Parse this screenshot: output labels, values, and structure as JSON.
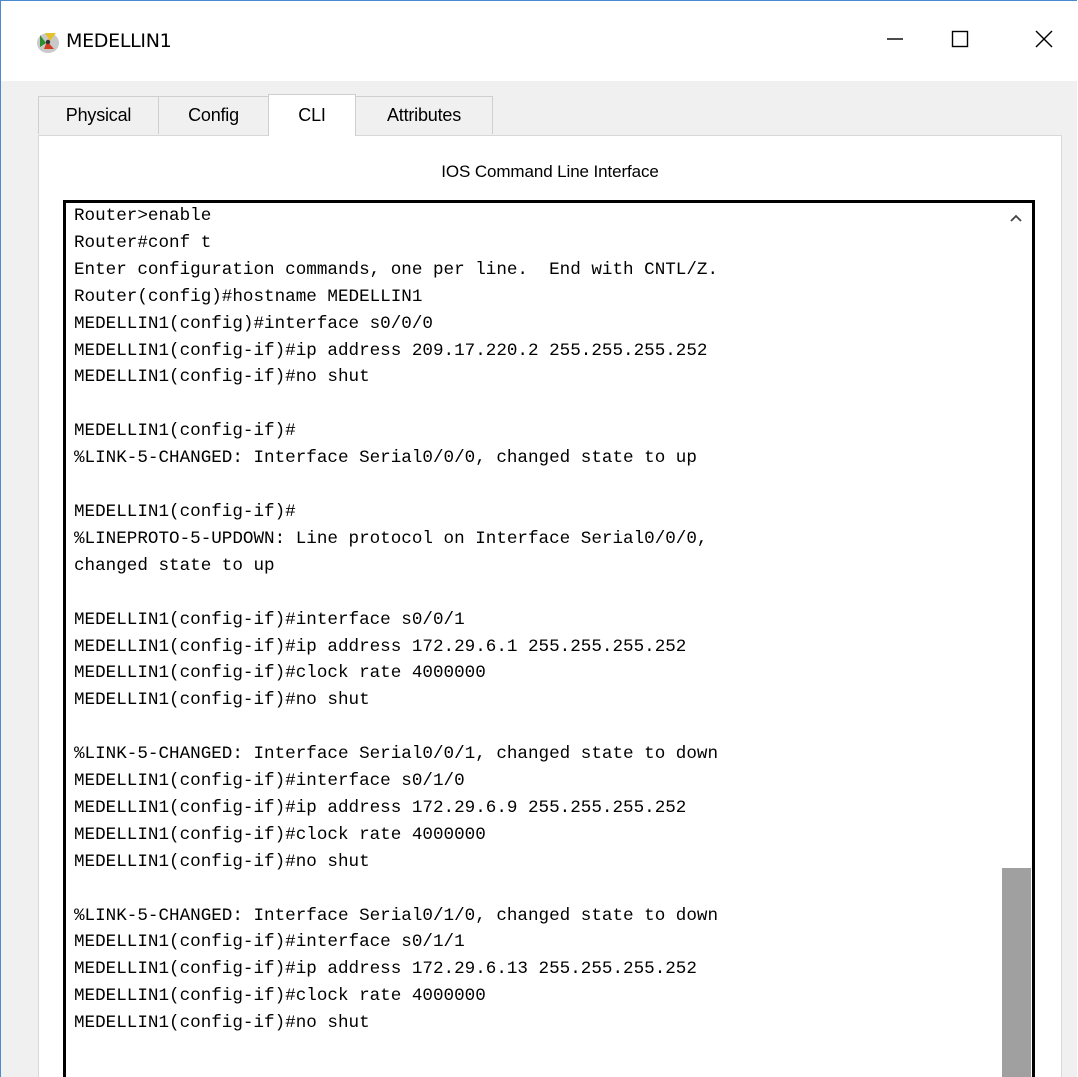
{
  "window": {
    "title": "MEDELLIN1",
    "icon": "router-app-icon",
    "controls": {
      "minimize": "minimize-icon",
      "maximize": "maximize-icon",
      "close": "close-icon"
    }
  },
  "tabs": [
    {
      "label": "Physical",
      "active": false
    },
    {
      "label": "Config",
      "active": false
    },
    {
      "label": "CLI",
      "active": true
    },
    {
      "label": "Attributes",
      "active": false
    }
  ],
  "panel": {
    "header": "IOS Command Line Interface"
  },
  "terminal": {
    "lines": [
      "Router>enable",
      "Router#conf t",
      "Enter configuration commands, one per line.  End with CNTL/Z.",
      "Router(config)#hostname MEDELLIN1",
      "MEDELLIN1(config)#interface s0/0/0",
      "MEDELLIN1(config-if)#ip address 209.17.220.2 255.255.255.252",
      "MEDELLIN1(config-if)#no shut",
      "",
      "MEDELLIN1(config-if)#",
      "%LINK-5-CHANGED: Interface Serial0/0/0, changed state to up",
      "",
      "MEDELLIN1(config-if)#",
      "%LINEPROTO-5-UPDOWN: Line protocol on Interface Serial0/0/0,",
      "changed state to up",
      "",
      "MEDELLIN1(config-if)#interface s0/0/1",
      "MEDELLIN1(config-if)#ip address 172.29.6.1 255.255.255.252",
      "MEDELLIN1(config-if)#clock rate 4000000",
      "MEDELLIN1(config-if)#no shut",
      "",
      "%LINK-5-CHANGED: Interface Serial0/0/1, changed state to down",
      "MEDELLIN1(config-if)#interface s0/1/0",
      "MEDELLIN1(config-if)#ip address 172.29.6.9 255.255.255.252",
      "MEDELLIN1(config-if)#clock rate 4000000",
      "MEDELLIN1(config-if)#no shut",
      "",
      "%LINK-5-CHANGED: Interface Serial0/1/0, changed state to down",
      "MEDELLIN1(config-if)#interface s0/1/1",
      "MEDELLIN1(config-if)#ip address 172.29.6.13 255.255.255.252",
      "MEDELLIN1(config-if)#clock rate 4000000",
      "MEDELLIN1(config-if)#no shut"
    ]
  },
  "scrollbar": {
    "up_icon": "chevron-up-icon",
    "position_fraction": 0.74
  },
  "colors": {
    "window_border": "#4a8ad0",
    "client_bg": "#f0f0f0",
    "terminal_border": "#000000",
    "scroll_thumb": "#a0a0a0"
  }
}
